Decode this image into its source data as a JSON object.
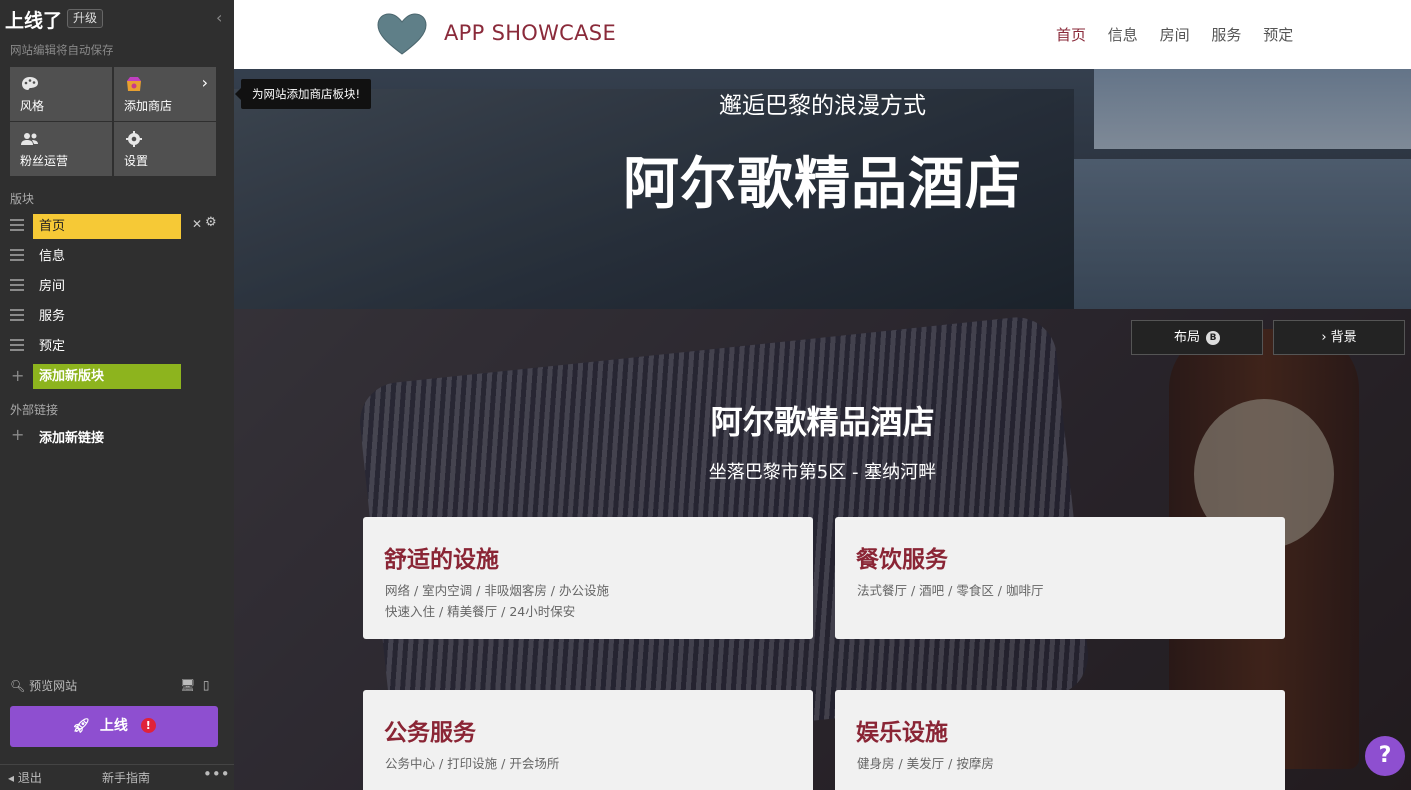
{
  "sidebar": {
    "brand": "上线了",
    "upgrade": "升级",
    "autosave": "网站编辑将自动保存",
    "tools": [
      {
        "label": "风格",
        "icon": "palette-icon"
      },
      {
        "label": "添加商店",
        "icon": "shop-icon"
      },
      {
        "label": "粉丝运营",
        "icon": "fans-icon"
      },
      {
        "label": "设置",
        "icon": "gear-icon"
      }
    ],
    "sections_label": "版块",
    "pages": [
      {
        "label": "首页",
        "active": true
      },
      {
        "label": "信息"
      },
      {
        "label": "房间"
      },
      {
        "label": "服务"
      },
      {
        "label": "预定"
      }
    ],
    "add_section": "添加新版块",
    "external_label": "外部链接",
    "add_link": "添加新链接",
    "preview": "预览网站",
    "launch": "上线",
    "launch_warn": "!",
    "footer": {
      "exit": "退出",
      "guide": "新手指南",
      "more": "•••"
    }
  },
  "tooltip": "为网站添加商店板块!",
  "site": {
    "logo_text": "APP SHOWCASE",
    "nav": [
      "首页",
      "信息",
      "房间",
      "服务",
      "预定"
    ],
    "hero": {
      "subtitle": "邂逅巴黎的浪漫方式",
      "title": "阿尔歌精品酒店"
    },
    "controls": {
      "layout": "布局",
      "layout_badge": "B",
      "background": "› 背景"
    },
    "feature": {
      "title": "阿尔歌精品酒店",
      "subtitle": "坐落巴黎市第5区 - 塞纳河畔",
      "cards": [
        {
          "title": "舒适的设施",
          "lines": [
            "网络 / 室内空调 / 非吸烟客房 / 办公设施",
            "快速入住 / 精美餐厅 / 24小时保安"
          ]
        },
        {
          "title": "餐饮服务",
          "lines": [
            "法式餐厅 / 酒吧 / 零食区 / 咖啡厅"
          ]
        },
        {
          "title": "公务服务",
          "lines": [
            "公务中心 / 打印设施 / 开会场所"
          ]
        },
        {
          "title": "娱乐设施",
          "lines": [
            "健身房 / 美发厅 / 按摩房"
          ]
        }
      ]
    },
    "help": "?"
  },
  "colors": {
    "sidebar_bg": "#2f2f2f",
    "active_page": "#f6c936",
    "add_section": "#8db41e",
    "launch": "#8e4fd0",
    "accent": "#8a2535",
    "logo_heart": "#5f7f88"
  }
}
